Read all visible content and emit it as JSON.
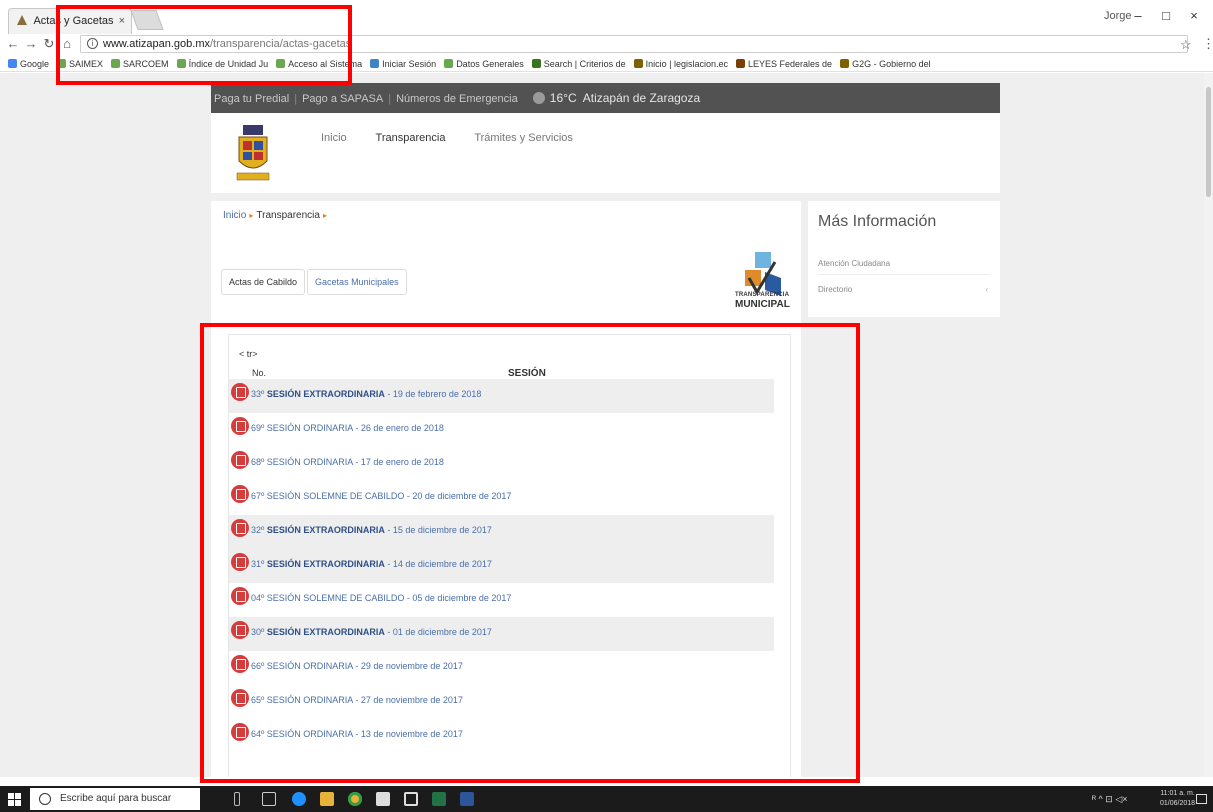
{
  "browser": {
    "tab_title": "Actas y Gacetas",
    "tab_close": "×",
    "user_name": "Jorge",
    "window_minimize": "–",
    "window_maximize": "□",
    "window_close": "×",
    "url_domain": "www.atizapan.gob.mx",
    "url_path": "/transparencia/actas-gacetas",
    "bookmarks": [
      {
        "label": "Google",
        "color": "#4285f4"
      },
      {
        "label": "SAIMEX",
        "color": "#6aa84f"
      },
      {
        "label": "SARCOEM",
        "color": "#6aa84f"
      },
      {
        "label": "Índice de Unidad Ju",
        "color": "#6aa84f"
      },
      {
        "label": "Acceso al Sistema",
        "color": "#6aa84f"
      },
      {
        "label": "Iniciar Sesión",
        "color": "#3d85c6"
      },
      {
        "label": "Datos Generales",
        "color": "#6aa84f"
      },
      {
        "label": "Search | Criterios de",
        "color": "#38761d"
      },
      {
        "label": "Inicio | legislacion.ec",
        "color": "#7f6000"
      },
      {
        "label": "LEYES Federales de",
        "color": "#783f04"
      },
      {
        "label": "G2G - Gobierno del",
        "color": "#7f6000"
      }
    ]
  },
  "site": {
    "topbar": {
      "links": [
        "Paga tu Predial",
        "Pago a SAPASA",
        "Números de Emergencia"
      ],
      "temperature": "16°C",
      "city": "Atizapán de Zaragoza"
    },
    "nav": [
      {
        "label": "Inicio"
      },
      {
        "label": "Transparencia"
      },
      {
        "label": "Trámites y Servicios"
      }
    ],
    "breadcrumb": {
      "home": "Inicio",
      "current": "Transparencia"
    },
    "tabs": [
      {
        "label": "Actas de Cabildo"
      },
      {
        "label": "Gacetas Municipales"
      }
    ],
    "logo_text_1": "TRANSPARENCIA",
    "logo_text_2": "MUNICIPAL",
    "table": {
      "raw_text": "< tr>",
      "col_no": "No.",
      "col_sesion": "SESIÓN",
      "rows": [
        {
          "prefix": "33º ",
          "bold": "SESIÓN EXTRAORDINARIA",
          "suffix": " - 19 de febrero de 2018",
          "shaded": true
        },
        {
          "prefix": "69º SESIÓN ORDINARIA",
          "bold": "",
          "suffix": " - 26 de enero de 2018",
          "shaded": false
        },
        {
          "prefix": "68º SESIÓN ORDINARIA",
          "bold": "",
          "suffix": " - 17 de enero de 2018",
          "shaded": false
        },
        {
          "prefix": "67º SESIÓN SOLEMNE DE CABILDO",
          "bold": "",
          "suffix": " - 20 de diciembre de 2017",
          "shaded": false
        },
        {
          "prefix": "32º ",
          "bold": "SESIÓN EXTRAORDINARIA",
          "suffix": " - 15 de diciembre de 2017",
          "shaded": true
        },
        {
          "prefix": "31º ",
          "bold": "SESIÓN EXTRAORDINARIA",
          "suffix": " - 14 de diciembre de 2017",
          "shaded": true
        },
        {
          "prefix": "04º SESIÓN SOLEMNE DE CABILDO",
          "bold": "",
          "suffix": " - 05 de diciembre de 2017",
          "shaded": false
        },
        {
          "prefix": "30º ",
          "bold": "SESIÓN EXTRAORDINARIA",
          "suffix": " - 01 de diciembre de 2017",
          "shaded": true
        },
        {
          "prefix": "66º SESIÓN ORDINARIA",
          "bold": "",
          "suffix": " - 29 de noviembre de 2017",
          "shaded": false
        },
        {
          "prefix": "65º SESIÓN ORDINARIA",
          "bold": "",
          "suffix": " - 27 de noviembre de 2017",
          "shaded": false
        },
        {
          "prefix": "64º SESIÓN ORDINARIA",
          "bold": "",
          "suffix": " - 13 de noviembre de 2017",
          "shaded": false
        }
      ]
    },
    "sidebar": {
      "title": "Más Información",
      "items": [
        {
          "label": "Atención Ciudadana",
          "chevron": ""
        },
        {
          "label": "Directorio",
          "chevron": "‹"
        }
      ]
    }
  },
  "taskbar": {
    "search_placeholder": "Escribe aquí para buscar",
    "clock_time": "11:01 a. m.",
    "clock_date": "01/06/2018",
    "tray_glyphs": "ᴿ  ^  ⊡ ◁×"
  },
  "colors": {
    "annotation_red": "#ff0000",
    "link_blue": "#4a6ea8",
    "pdf_red": "#d63c3c",
    "topbar_gray": "#525252"
  }
}
